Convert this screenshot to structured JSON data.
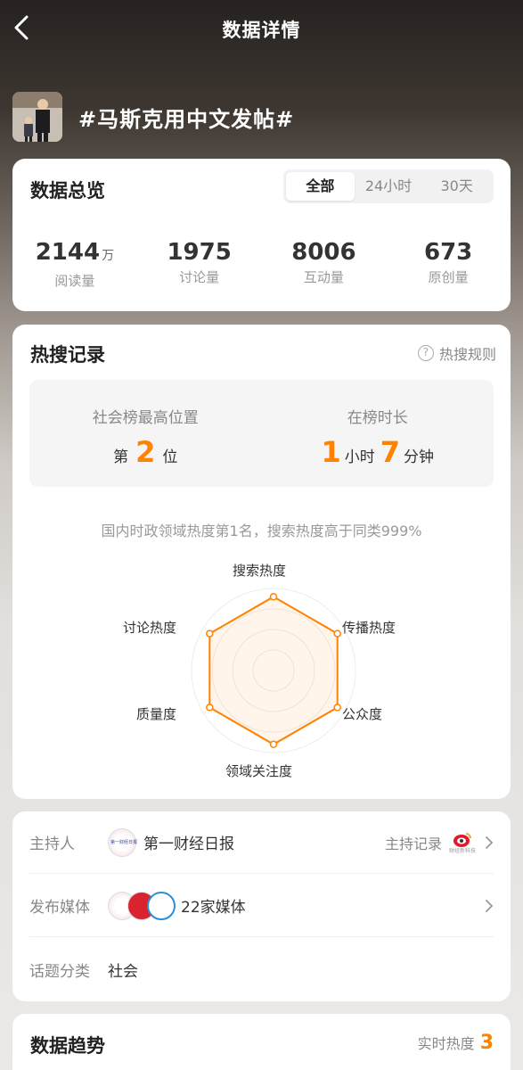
{
  "nav": {
    "title": "数据详情",
    "back_icon": "back-arrow-icon"
  },
  "topic": {
    "title": "#马斯克用中文发帖#"
  },
  "overview": {
    "title": "数据总览",
    "tabs": [
      {
        "label": "全部",
        "active": true
      },
      {
        "label": "24小时",
        "active": false
      },
      {
        "label": "30天",
        "active": false
      }
    ],
    "stats": [
      {
        "value": "2144",
        "unit": "万",
        "label": "阅读量"
      },
      {
        "value": "1975",
        "unit": "",
        "label": "讨论量"
      },
      {
        "value": "8006",
        "unit": "",
        "label": "互动量"
      },
      {
        "value": "673",
        "unit": "",
        "label": "原创量"
      }
    ]
  },
  "hot": {
    "title": "热搜记录",
    "rule_label": "热搜规则",
    "rule_icon": "question-circle-icon",
    "best_rank": {
      "label": "社会榜最高位置",
      "prefix": "第",
      "value": "2",
      "suffix": "位"
    },
    "duration": {
      "label": "在榜时长",
      "hours": "1",
      "hours_unit": "小时",
      "minutes": "7",
      "minutes_unit": "分钟"
    },
    "note": "国内时政领域热度第1名，搜索热度高于同类999%",
    "radar": {
      "axes": [
        "搜索热度",
        "传播热度",
        "公众度",
        "领域关注度",
        "质量度",
        "讨论热度"
      ],
      "values": [
        0.9,
        0.9,
        0.9,
        0.9,
        0.9,
        0.9
      ],
      "color": "#ff8200"
    }
  },
  "info": {
    "host": {
      "label": "主持人",
      "value": "第一财经日报",
      "link": "主持记录",
      "logo_text": "第一财经日报",
      "badge_text": "财经新科技"
    },
    "media": {
      "label": "发布媒体",
      "value": "22家媒体"
    },
    "category": {
      "label": "话题分类",
      "value": "社会"
    }
  },
  "trend": {
    "title": "数据趋势",
    "live_label": "实时热度",
    "live_value": "3"
  },
  "colors": {
    "accent": "#ff8200"
  }
}
